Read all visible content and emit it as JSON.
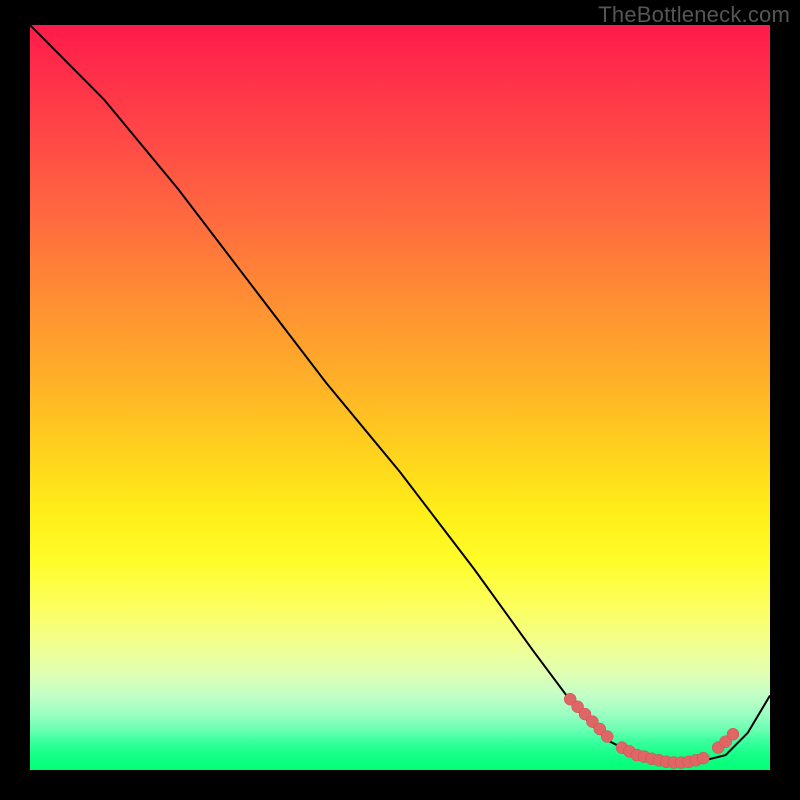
{
  "watermark": "TheBottleneck.com",
  "chart_data": {
    "type": "line",
    "title": "",
    "xlabel": "",
    "ylabel": "",
    "xlim": [
      0,
      100
    ],
    "ylim": [
      0,
      100
    ],
    "series": [
      {
        "name": "bottleneck-curve",
        "x": [
          0,
          6,
          10,
          20,
          30,
          40,
          50,
          60,
          68,
          74,
          78,
          82,
          86,
          90,
          94,
          97,
          100
        ],
        "y": [
          100,
          94,
          90,
          78,
          65,
          52,
          40,
          27,
          16,
          8,
          4,
          2,
          1,
          1,
          2,
          5,
          10
        ]
      }
    ],
    "highlight_points": {
      "name": "highlighted-range",
      "x": [
        73,
        74,
        75,
        76,
        77,
        78,
        80,
        81,
        82,
        83,
        84,
        85,
        86,
        87,
        88,
        89,
        90,
        91,
        93,
        94,
        95
      ],
      "y": [
        9.5,
        8.5,
        7.5,
        6.5,
        5.5,
        4.5,
        3.0,
        2.5,
        2.0,
        1.8,
        1.5,
        1.3,
        1.1,
        1.0,
        1.0,
        1.1,
        1.3,
        1.6,
        3.0,
        3.8,
        4.8
      ]
    },
    "background": {
      "type": "vertical-gradient",
      "stops": [
        {
          "pos": 0.0,
          "color": "#ff1a4a"
        },
        {
          "pos": 0.5,
          "color": "#ffc020"
        },
        {
          "pos": 0.72,
          "color": "#fffc2a"
        },
        {
          "pos": 0.9,
          "color": "#c2ffc7"
        },
        {
          "pos": 1.0,
          "color": "#02ff76"
        }
      ]
    }
  }
}
